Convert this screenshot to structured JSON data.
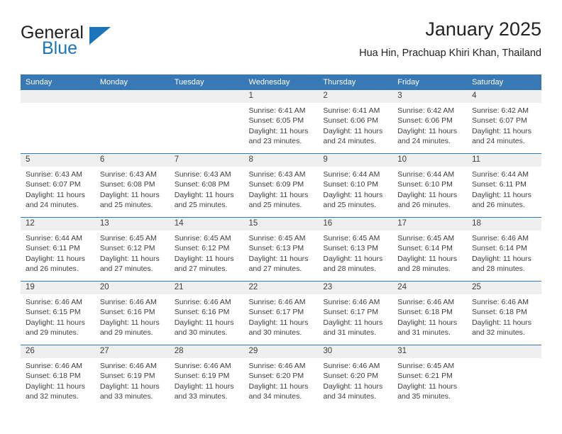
{
  "brand": {
    "name_top": "General",
    "name_bottom": "Blue",
    "triangle_icon": "triangle-icon",
    "color_dark": "#231f20",
    "color_blue": "#1b75bb"
  },
  "header": {
    "title": "January 2025",
    "subtitle": "Hua Hin, Prachuap Khiri Khan, Thailand"
  },
  "theme": {
    "header_bg": "#3878b4",
    "header_text": "#ffffff",
    "daynum_band_bg": "#efefef",
    "cell_bg": "#ffffff",
    "row_divider": "#3878b4",
    "body_text": "#3f3f3f"
  },
  "weekdays": [
    "Sunday",
    "Monday",
    "Tuesday",
    "Wednesday",
    "Thursday",
    "Friday",
    "Saturday"
  ],
  "weeks": [
    [
      {
        "day": "",
        "lines": []
      },
      {
        "day": "",
        "lines": []
      },
      {
        "day": "",
        "lines": []
      },
      {
        "day": "1",
        "lines": [
          "Sunrise: 6:41 AM",
          "Sunset: 6:05 PM",
          "Daylight: 11 hours",
          "and 23 minutes."
        ]
      },
      {
        "day": "2",
        "lines": [
          "Sunrise: 6:41 AM",
          "Sunset: 6:06 PM",
          "Daylight: 11 hours",
          "and 24 minutes."
        ]
      },
      {
        "day": "3",
        "lines": [
          "Sunrise: 6:42 AM",
          "Sunset: 6:06 PM",
          "Daylight: 11 hours",
          "and 24 minutes."
        ]
      },
      {
        "day": "4",
        "lines": [
          "Sunrise: 6:42 AM",
          "Sunset: 6:07 PM",
          "Daylight: 11 hours",
          "and 24 minutes."
        ]
      }
    ],
    [
      {
        "day": "5",
        "lines": [
          "Sunrise: 6:43 AM",
          "Sunset: 6:07 PM",
          "Daylight: 11 hours",
          "and 24 minutes."
        ]
      },
      {
        "day": "6",
        "lines": [
          "Sunrise: 6:43 AM",
          "Sunset: 6:08 PM",
          "Daylight: 11 hours",
          "and 25 minutes."
        ]
      },
      {
        "day": "7",
        "lines": [
          "Sunrise: 6:43 AM",
          "Sunset: 6:08 PM",
          "Daylight: 11 hours",
          "and 25 minutes."
        ]
      },
      {
        "day": "8",
        "lines": [
          "Sunrise: 6:43 AM",
          "Sunset: 6:09 PM",
          "Daylight: 11 hours",
          "and 25 minutes."
        ]
      },
      {
        "day": "9",
        "lines": [
          "Sunrise: 6:44 AM",
          "Sunset: 6:10 PM",
          "Daylight: 11 hours",
          "and 25 minutes."
        ]
      },
      {
        "day": "10",
        "lines": [
          "Sunrise: 6:44 AM",
          "Sunset: 6:10 PM",
          "Daylight: 11 hours",
          "and 26 minutes."
        ]
      },
      {
        "day": "11",
        "lines": [
          "Sunrise: 6:44 AM",
          "Sunset: 6:11 PM",
          "Daylight: 11 hours",
          "and 26 minutes."
        ]
      }
    ],
    [
      {
        "day": "12",
        "lines": [
          "Sunrise: 6:44 AM",
          "Sunset: 6:11 PM",
          "Daylight: 11 hours",
          "and 26 minutes."
        ]
      },
      {
        "day": "13",
        "lines": [
          "Sunrise: 6:45 AM",
          "Sunset: 6:12 PM",
          "Daylight: 11 hours",
          "and 27 minutes."
        ]
      },
      {
        "day": "14",
        "lines": [
          "Sunrise: 6:45 AM",
          "Sunset: 6:12 PM",
          "Daylight: 11 hours",
          "and 27 minutes."
        ]
      },
      {
        "day": "15",
        "lines": [
          "Sunrise: 6:45 AM",
          "Sunset: 6:13 PM",
          "Daylight: 11 hours",
          "and 27 minutes."
        ]
      },
      {
        "day": "16",
        "lines": [
          "Sunrise: 6:45 AM",
          "Sunset: 6:13 PM",
          "Daylight: 11 hours",
          "and 28 minutes."
        ]
      },
      {
        "day": "17",
        "lines": [
          "Sunrise: 6:45 AM",
          "Sunset: 6:14 PM",
          "Daylight: 11 hours",
          "and 28 minutes."
        ]
      },
      {
        "day": "18",
        "lines": [
          "Sunrise: 6:46 AM",
          "Sunset: 6:14 PM",
          "Daylight: 11 hours",
          "and 28 minutes."
        ]
      }
    ],
    [
      {
        "day": "19",
        "lines": [
          "Sunrise: 6:46 AM",
          "Sunset: 6:15 PM",
          "Daylight: 11 hours",
          "and 29 minutes."
        ]
      },
      {
        "day": "20",
        "lines": [
          "Sunrise: 6:46 AM",
          "Sunset: 6:16 PM",
          "Daylight: 11 hours",
          "and 29 minutes."
        ]
      },
      {
        "day": "21",
        "lines": [
          "Sunrise: 6:46 AM",
          "Sunset: 6:16 PM",
          "Daylight: 11 hours",
          "and 30 minutes."
        ]
      },
      {
        "day": "22",
        "lines": [
          "Sunrise: 6:46 AM",
          "Sunset: 6:17 PM",
          "Daylight: 11 hours",
          "and 30 minutes."
        ]
      },
      {
        "day": "23",
        "lines": [
          "Sunrise: 6:46 AM",
          "Sunset: 6:17 PM",
          "Daylight: 11 hours",
          "and 31 minutes."
        ]
      },
      {
        "day": "24",
        "lines": [
          "Sunrise: 6:46 AM",
          "Sunset: 6:18 PM",
          "Daylight: 11 hours",
          "and 31 minutes."
        ]
      },
      {
        "day": "25",
        "lines": [
          "Sunrise: 6:46 AM",
          "Sunset: 6:18 PM",
          "Daylight: 11 hours",
          "and 32 minutes."
        ]
      }
    ],
    [
      {
        "day": "26",
        "lines": [
          "Sunrise: 6:46 AM",
          "Sunset: 6:18 PM",
          "Daylight: 11 hours",
          "and 32 minutes."
        ]
      },
      {
        "day": "27",
        "lines": [
          "Sunrise: 6:46 AM",
          "Sunset: 6:19 PM",
          "Daylight: 11 hours",
          "and 33 minutes."
        ]
      },
      {
        "day": "28",
        "lines": [
          "Sunrise: 6:46 AM",
          "Sunset: 6:19 PM",
          "Daylight: 11 hours",
          "and 33 minutes."
        ]
      },
      {
        "day": "29",
        "lines": [
          "Sunrise: 6:46 AM",
          "Sunset: 6:20 PM",
          "Daylight: 11 hours",
          "and 34 minutes."
        ]
      },
      {
        "day": "30",
        "lines": [
          "Sunrise: 6:46 AM",
          "Sunset: 6:20 PM",
          "Daylight: 11 hours",
          "and 34 minutes."
        ]
      },
      {
        "day": "31",
        "lines": [
          "Sunrise: 6:45 AM",
          "Sunset: 6:21 PM",
          "Daylight: 11 hours",
          "and 35 minutes."
        ]
      },
      {
        "day": "",
        "lines": []
      }
    ]
  ]
}
